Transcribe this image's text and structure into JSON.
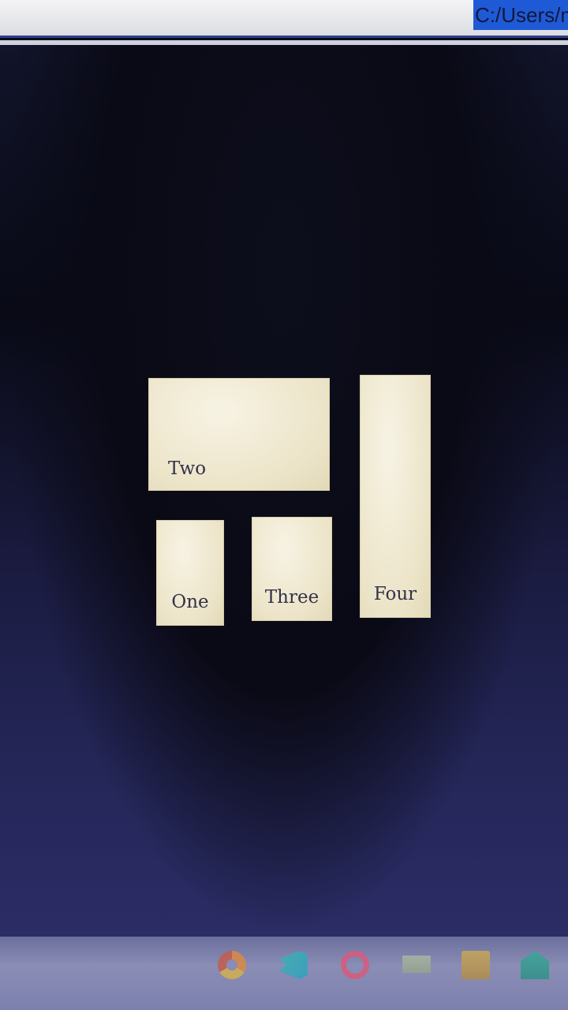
{
  "browser": {
    "address_text": "C:/Users/m"
  },
  "page": {
    "cards": {
      "two": "Two",
      "one": "One",
      "three": "Three",
      "four": "Four"
    }
  },
  "taskbar": {
    "icons": [
      "chrome-icon",
      "vscode-icon",
      "opera-icon",
      "files-icon",
      "store-icon",
      "mail-icon"
    ]
  },
  "colors": {
    "card_background": "#efe8cf",
    "page_background": "#0b0c1a",
    "address_highlight": "#1f5ad6"
  }
}
